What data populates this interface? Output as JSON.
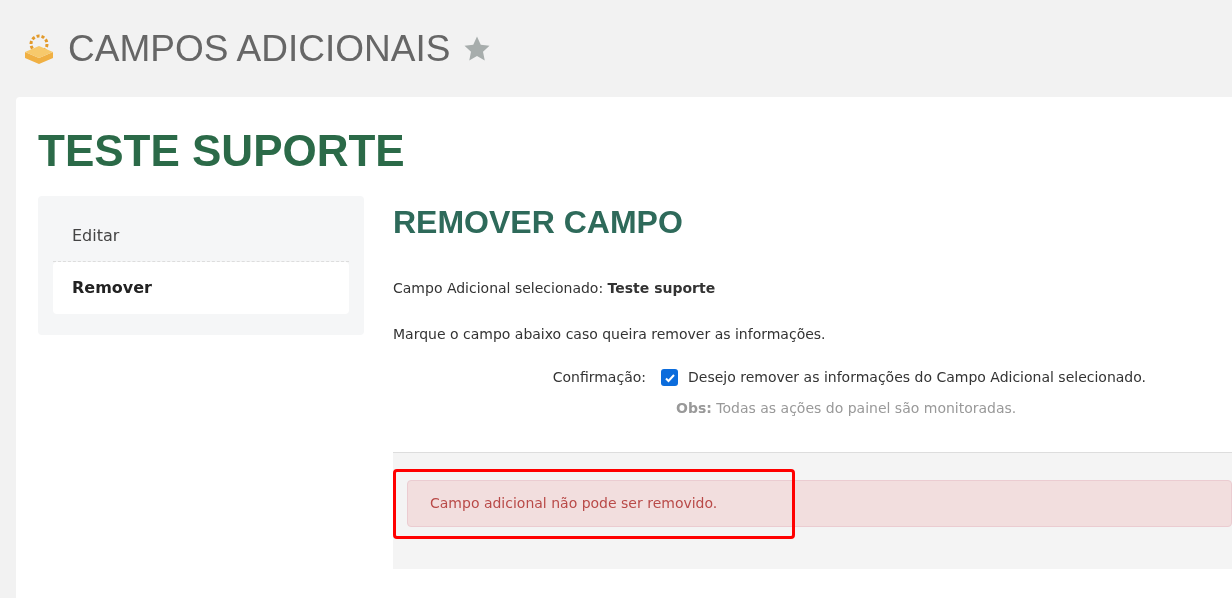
{
  "page": {
    "title": "CAMPOS ADICIONAIS",
    "favorite": false
  },
  "record_title": "TESTE SUPORTE",
  "sidebar": {
    "items": [
      {
        "label": "Editar",
        "selected": false
      },
      {
        "label": "Remover",
        "selected": true
      }
    ]
  },
  "section": {
    "title": "REMOVER CAMPO",
    "selected_field": "Campo Adicional selecionado: **Teste suporte**",
    "instruction": "Marque o campo abaixo caso queira remover as informações.",
    "confirm": {
      "label": "Confirmação:",
      "checked": true,
      "text": "Desejo remover as informações do Campo Adicional selecionado."
    },
    "note": "**Obs:** Todas as ações do painel são monitoradas."
  },
  "alert": {
    "message": "Campo adicional não pode ser removido."
  }
}
